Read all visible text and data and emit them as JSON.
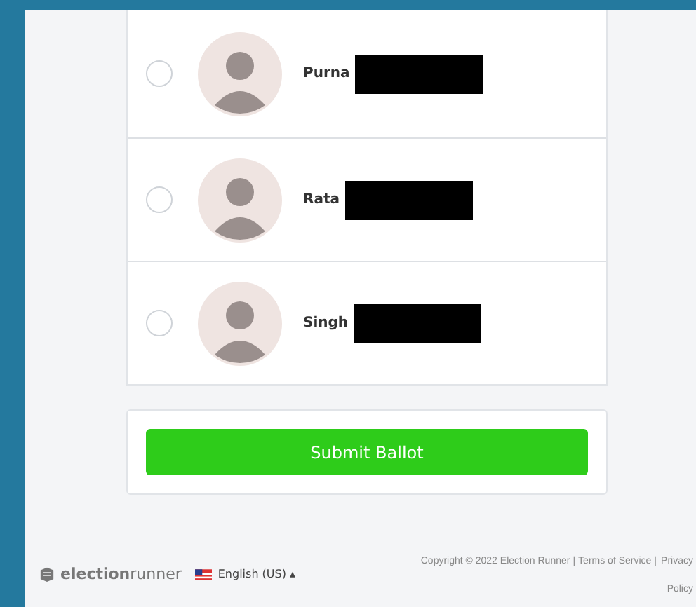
{
  "candidates": [
    {
      "name": "Purna",
      "selected": false
    },
    {
      "name": "Rata",
      "selected": false
    },
    {
      "name": "Singh",
      "selected": false
    }
  ],
  "submit_button": "Submit Ballot",
  "footer": {
    "logo": {
      "bold": "election",
      "light": "runner"
    },
    "language": "English (US)",
    "caret": "▴",
    "copyright": "Copyright © 2022 Election Runner",
    "links": [
      "Terms of Service",
      "Privacy Policy"
    ],
    "separator": "|"
  }
}
